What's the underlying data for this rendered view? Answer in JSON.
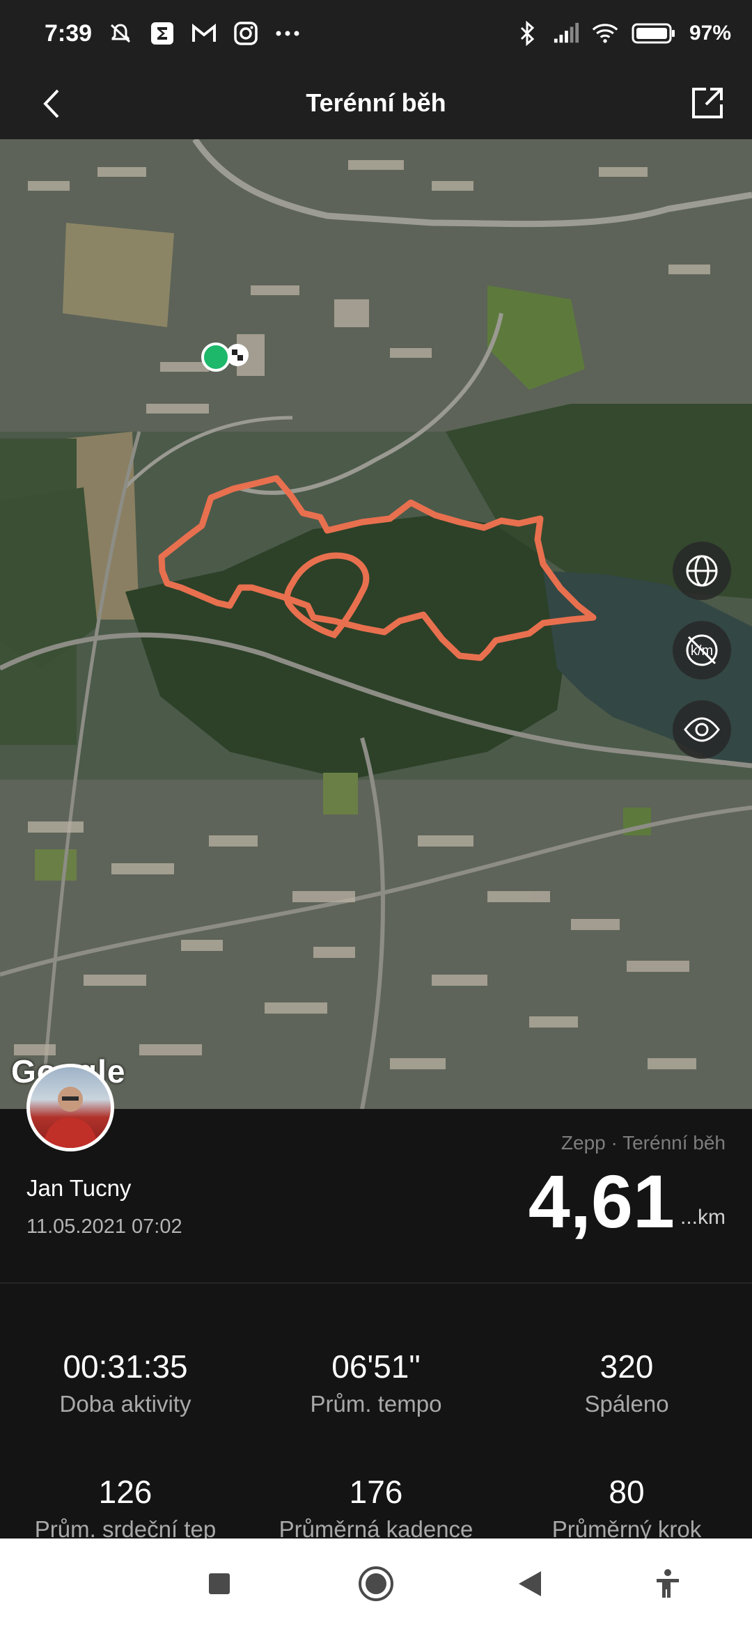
{
  "status_bar": {
    "time": "7:39",
    "battery": "97",
    "left_icons": [
      "mute-icon",
      "sigma-app-icon",
      "gmail-icon",
      "instagram-icon",
      "more-dots-icon"
    ],
    "right_icons": [
      "bluetooth-icon",
      "signal-icon",
      "wifi-icon",
      "battery-icon"
    ]
  },
  "header": {
    "title": "Terénní běh",
    "back_icon": "back-arrow-icon",
    "share_icon": "share-icon"
  },
  "map": {
    "provider": "Google",
    "route_color": "#e8704f",
    "start_marker_color": "#1db86a",
    "buttons": [
      {
        "icon": "globe-icon"
      },
      {
        "icon": "km-markers-off-icon"
      },
      {
        "icon": "eye-icon"
      }
    ]
  },
  "summary": {
    "user_name": "Jan Tucny",
    "date": "11.05.2021 07:02",
    "source": "Zepp · Terénní běh",
    "distance": "4,61",
    "distance_unit": "...km"
  },
  "stats": [
    {
      "value": "00:31:35",
      "label": "Doba aktivity"
    },
    {
      "value": "06'51\"",
      "label": "Prům. tempo"
    },
    {
      "value": "320",
      "label": "Spáleno"
    },
    {
      "value": "126",
      "label": "Prům. srdeční tep"
    },
    {
      "value": "176",
      "label": "Průměrná kadence"
    },
    {
      "value": "80",
      "label": "Průměrný krok"
    }
  ],
  "nav_bar": {
    "buttons": [
      "recents-square-icon",
      "home-circle-icon",
      "back-triangle-icon",
      "accessibility-icon"
    ]
  }
}
